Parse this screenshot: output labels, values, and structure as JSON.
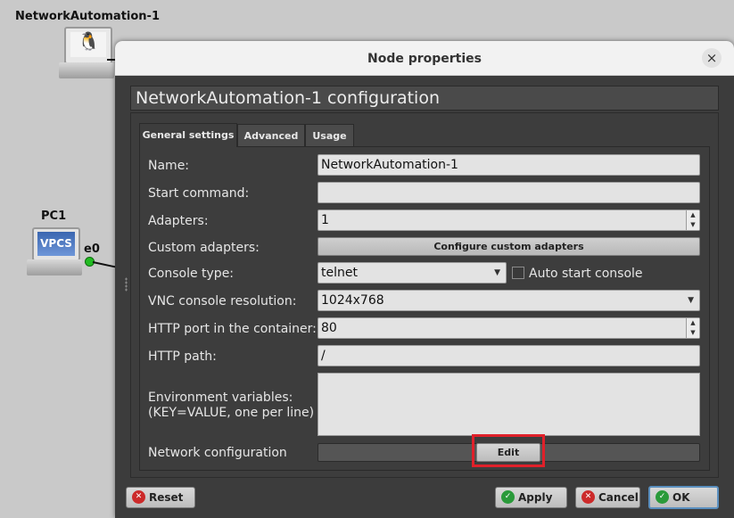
{
  "canvas": {
    "node1_label": "NetworkAutomation-1",
    "pc1_label": "PC1",
    "pc1_screen_text": "VPCS",
    "port_label": "e0"
  },
  "dialog": {
    "title": "Node properties",
    "close_glyph": "×",
    "header": "NetworkAutomation-1 configuration",
    "tabs": [
      {
        "label": "General settings",
        "active": true
      },
      {
        "label": "Advanced",
        "active": false
      },
      {
        "label": "Usage",
        "active": false
      }
    ],
    "fields": {
      "name_label": "Name:",
      "name_value": "NetworkAutomation-1",
      "start_command_label": "Start command:",
      "start_command_value": "",
      "adapters_label": "Adapters:",
      "adapters_value": "1",
      "custom_adapters_label": "Custom adapters:",
      "configure_adapters_button": "Configure custom adapters",
      "console_type_label": "Console type:",
      "console_type_value": "telnet",
      "auto_start_console_label": "Auto start console",
      "vnc_label": "VNC console resolution:",
      "vnc_value": "1024x768",
      "http_port_label": "HTTP port in the container:",
      "http_port_value": "80",
      "http_path_label": "HTTP path:",
      "http_path_value": "/",
      "env_label_line1": "Environment variables:",
      "env_label_line2": "(KEY=VALUE, one per line)",
      "env_value": "",
      "network_config_label": "Network configuration",
      "edit_button": "Edit"
    },
    "buttons": {
      "reset": "Reset",
      "apply": "Apply",
      "cancel": "Cancel",
      "ok": "OK"
    }
  },
  "colors": {
    "dialog_bg": "#3c3c3c",
    "highlight": "#e0202a",
    "port_up": "#22bb22"
  },
  "icons": {
    "spin_up": "▲",
    "spin_down": "▼",
    "combo_arrow": "▼",
    "reset_icon": "✕",
    "apply_icon": "✓",
    "cancel_icon": "✕",
    "ok_icon": "✓"
  }
}
